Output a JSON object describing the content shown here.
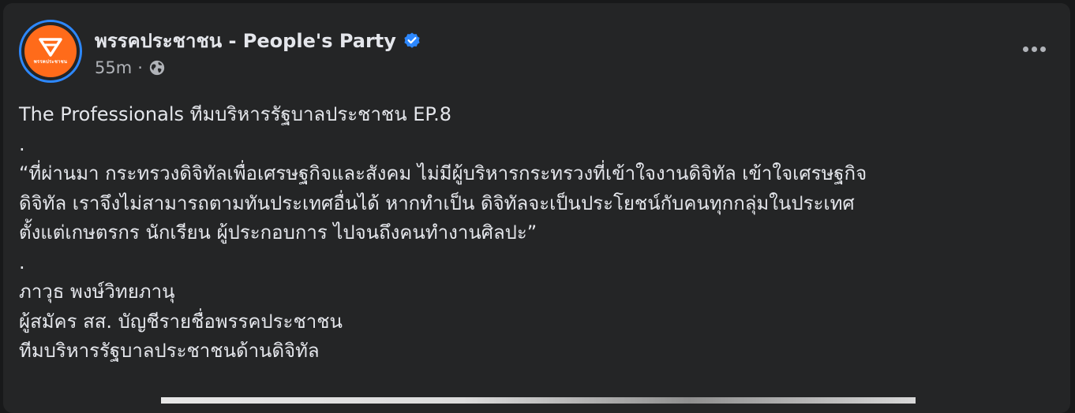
{
  "post": {
    "page_name": "พรรคประชาชน - People's Party",
    "avatar_text": "พรรคประชาชน",
    "time": "55m",
    "separator": "·",
    "icons": {
      "verified": "verified-badge-icon",
      "audience": "globe-icon",
      "menu": "more-options-icon"
    },
    "lines": [
      "The Professionals ทีมบริหารรัฐบาลประชาชน EP.8",
      ".",
      "“ที่ผ่านมา กระทรวงดิจิทัลเพื่อเศรษฐกิจและสังคม ไม่มีผู้บริหารกระทรวงที่เข้าใจงานดิจิทัล เข้าใจเศรษฐกิจ",
      "ดิจิทัล เราจึงไม่สามารถตามทันประเทศอื่นได้ หากทำเป็น ดิจิทัลจะเป็นประโยชน์กับคนทุกกลุ่มในประเทศ",
      "ตั้งแต่เกษตรกร นักเรียน ผู้ประกอบการ ไปจนถึงคนทำงานศิลปะ”",
      ".",
      "ภาวุธ พงษ์วิทยภานุ",
      "ผู้สมัคร สส. บัญชีรายชื่อพรรคประชาชน",
      "ทีมบริหารรัฐบาลประชาชนด้านดิจิทัล"
    ]
  },
  "colors": {
    "background": "#18191a",
    "card": "#242526",
    "primary_text": "#e4e6eb",
    "secondary_text": "#b0b3b8",
    "brand_orange": "#ff6b1a",
    "verified_blue": "#2d88ff"
  }
}
